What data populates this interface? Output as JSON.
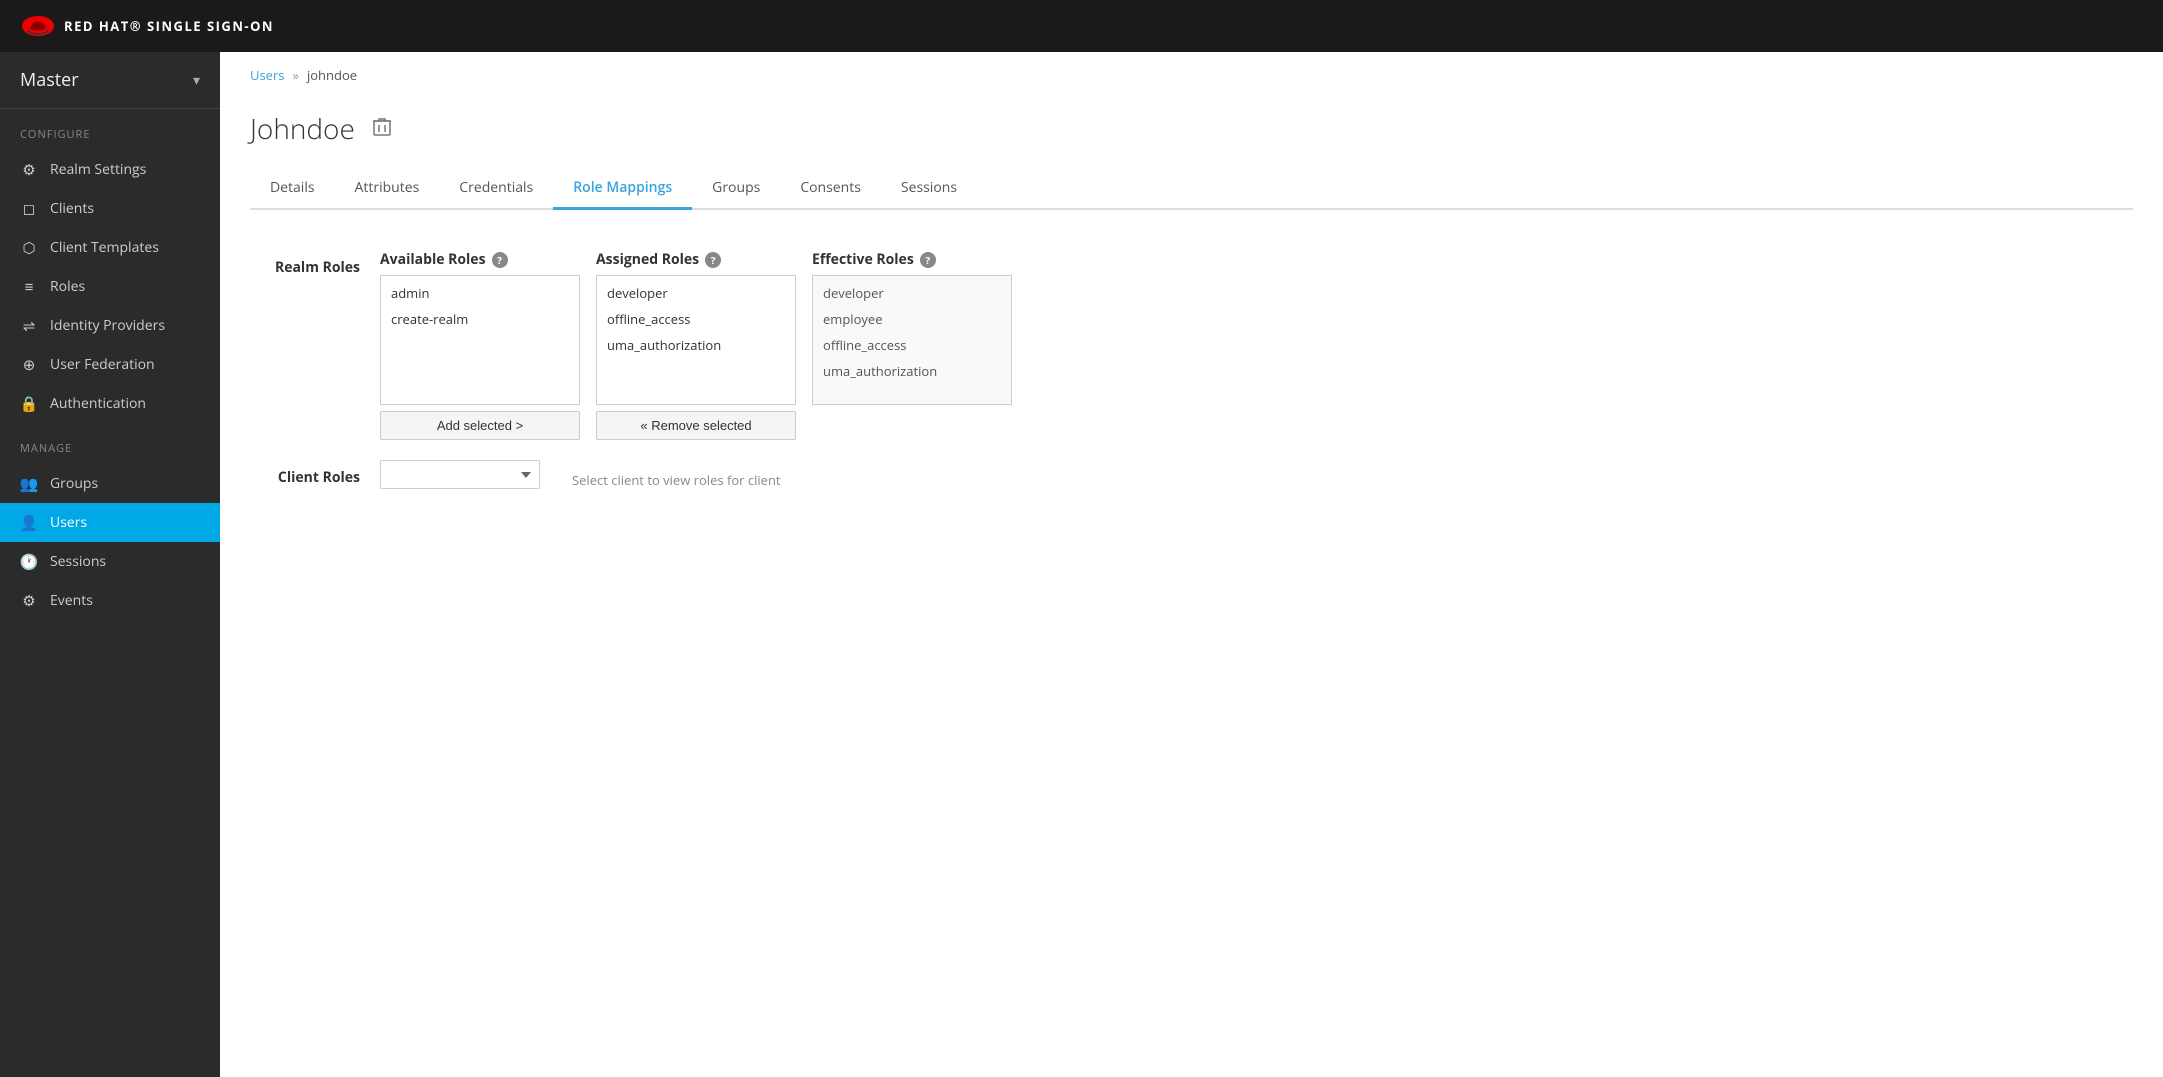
{
  "topbar": {
    "title": "RED HAT® SINGLE SIGN-ON"
  },
  "sidebar": {
    "realm": "Master",
    "configure_label": "Configure",
    "manage_label": "Manage",
    "configure_items": [
      {
        "id": "realm-settings",
        "label": "Realm Settings",
        "icon": "⚙"
      },
      {
        "id": "clients",
        "label": "Clients",
        "icon": "◻"
      },
      {
        "id": "client-templates",
        "label": "Client Templates",
        "icon": "⬡"
      },
      {
        "id": "roles",
        "label": "Roles",
        "icon": "≡"
      },
      {
        "id": "identity-providers",
        "label": "Identity Providers",
        "icon": "⇌"
      },
      {
        "id": "user-federation",
        "label": "User Federation",
        "icon": "⊕"
      },
      {
        "id": "authentication",
        "label": "Authentication",
        "icon": "🔒"
      }
    ],
    "manage_items": [
      {
        "id": "groups",
        "label": "Groups",
        "icon": "👥"
      },
      {
        "id": "users",
        "label": "Users",
        "icon": "👤",
        "active": true
      },
      {
        "id": "sessions",
        "label": "Sessions",
        "icon": "🕐"
      },
      {
        "id": "events",
        "label": "Events",
        "icon": "⚙"
      }
    ]
  },
  "breadcrumb": {
    "parent_label": "Users",
    "separator": "»",
    "current": "johndoe"
  },
  "page": {
    "title": "Johndoe",
    "delete_tooltip": "Delete"
  },
  "tabs": [
    {
      "id": "details",
      "label": "Details",
      "active": false
    },
    {
      "id": "attributes",
      "label": "Attributes",
      "active": false
    },
    {
      "id": "credentials",
      "label": "Credentials",
      "active": false
    },
    {
      "id": "role-mappings",
      "label": "Role Mappings",
      "active": true
    },
    {
      "id": "groups",
      "label": "Groups",
      "active": false
    },
    {
      "id": "consents",
      "label": "Consents",
      "active": false
    },
    {
      "id": "sessions",
      "label": "Sessions",
      "active": false
    }
  ],
  "role_mappings": {
    "realm_roles_label": "Realm Roles",
    "available_roles_label": "Available Roles",
    "assigned_roles_label": "Assigned Roles",
    "effective_roles_label": "Effective Roles",
    "available_roles": [
      "admin",
      "create-realm"
    ],
    "assigned_roles": [
      "developer",
      "offline_access",
      "uma_authorization"
    ],
    "effective_roles": [
      "developer",
      "employee",
      "offline_access",
      "uma_authorization"
    ],
    "add_selected_btn": "Add selected >",
    "remove_selected_btn": "« Remove selected",
    "client_roles_label": "Client Roles",
    "client_roles_hint": "Select client to view roles for client",
    "client_select_placeholder": ""
  }
}
